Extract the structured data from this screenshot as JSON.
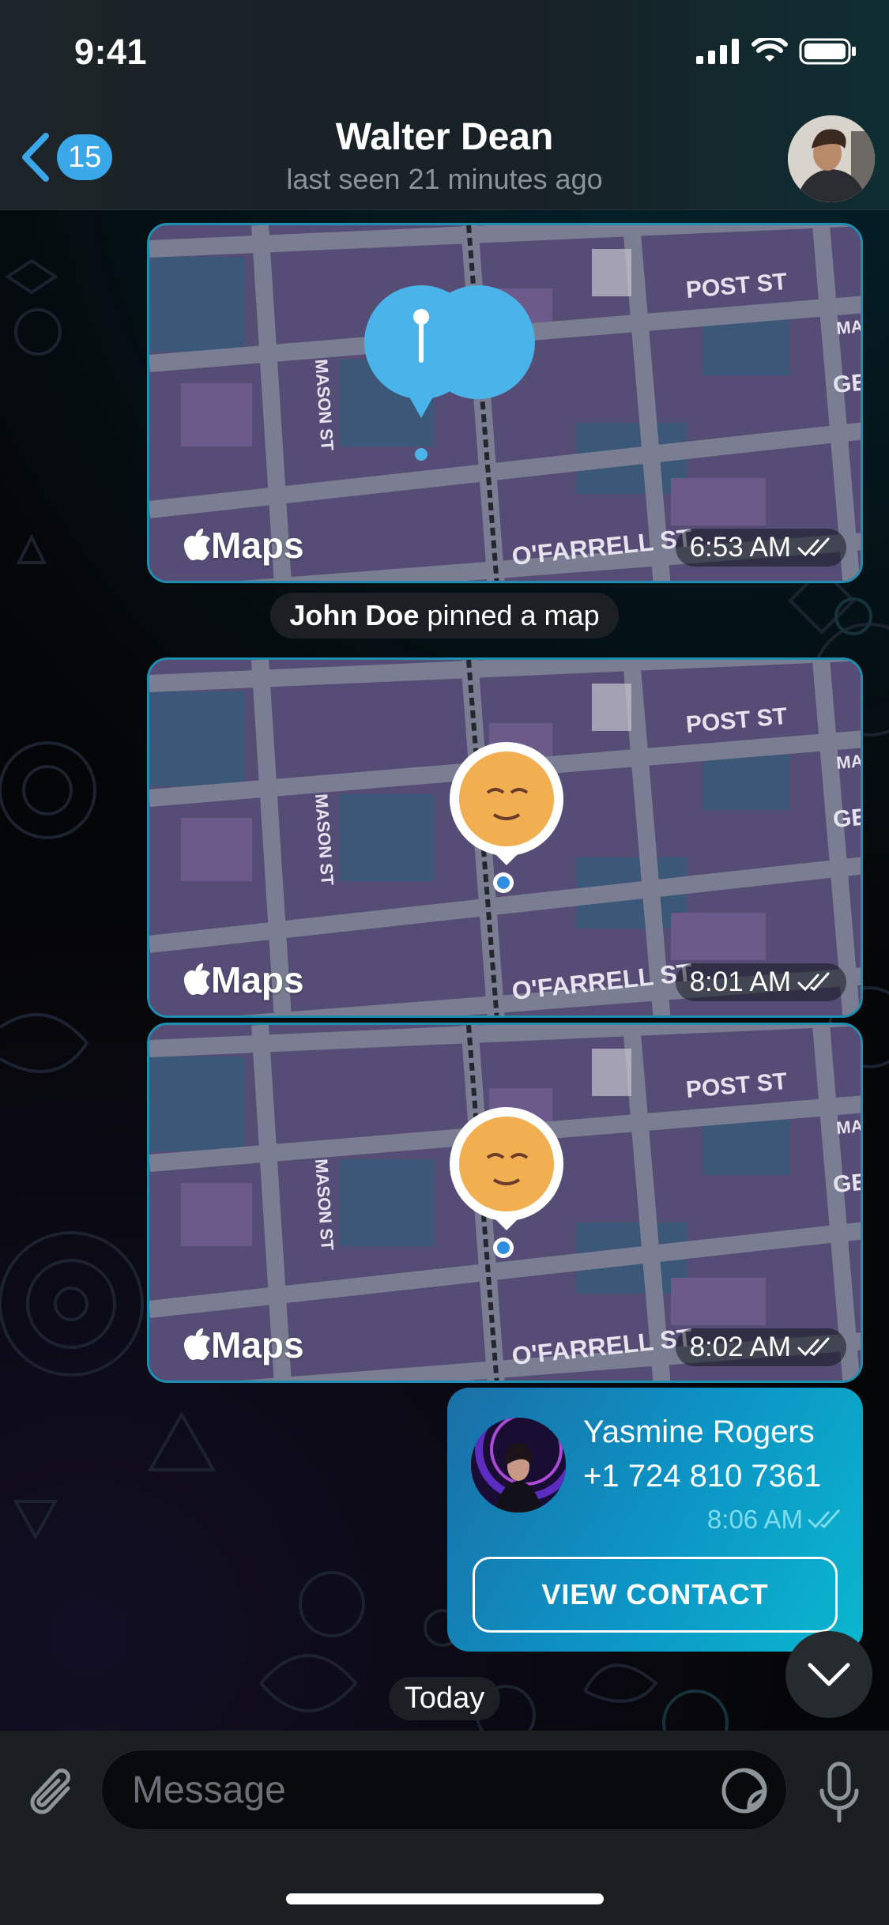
{
  "status_bar": {
    "time": "9:41"
  },
  "header": {
    "back_badge": "15",
    "title": "Walter Dean",
    "subtitle": "last seen 21 minutes ago"
  },
  "messages": [
    {
      "type": "map",
      "time": "6:53 AM",
      "logo_text": "Maps",
      "pin": "location-pin",
      "street_labels": [
        "POST ST",
        "MASON ST",
        "O'FARRELL ST",
        "MA",
        "GE"
      ]
    },
    {
      "type": "service",
      "actor": "John Doe",
      "text": " pinned a map"
    },
    {
      "type": "map",
      "time": "8:01 AM",
      "logo_text": "Maps",
      "pin": "live-location-avatar",
      "street_labels": [
        "POST ST",
        "MASON ST",
        "O'FARRELL ST",
        "MA",
        "GE"
      ]
    },
    {
      "type": "map",
      "time": "8:02 AM",
      "logo_text": "Maps",
      "pin": "live-location-avatar",
      "street_labels": [
        "POST ST",
        "MASON ST",
        "O'FARRELL ST",
        "MA",
        "GE"
      ]
    },
    {
      "type": "contact",
      "name": "Yasmine Rogers",
      "phone": "+1 724 810 7361",
      "time": "8:06 AM",
      "button": "VIEW CONTACT"
    }
  ],
  "date_separator": "Today",
  "input": {
    "placeholder": "Message"
  },
  "colors": {
    "accent": "#3aa7e8",
    "bubble_border": "#1e8fb0",
    "contact_bubble_start": "#1b6fa6",
    "contact_bubble_end": "#0ab7cf"
  }
}
